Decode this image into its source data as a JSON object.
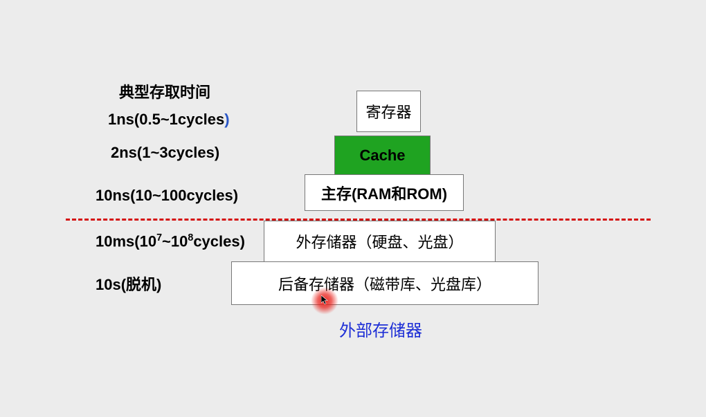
{
  "title": "典型存取时间",
  "times": {
    "t1_pre": "1ns(0.5~1cycles",
    "t1_suf": ")",
    "t2": "2ns(1~3cycles)",
    "t3": "10ns(10~100cycles)",
    "t4_pre": "10ms(10",
    "t4_sup1": "7",
    "t4_mid": "~10",
    "t4_sup2": "8",
    "t4_suf": "cycles)",
    "t5": "10s(脱机)"
  },
  "boxes": {
    "register": "寄存器",
    "cache": "Cache",
    "main": "主存(RAM和ROM)",
    "external": "外存储器（硬盘、光盘）",
    "backup": "后备存储器（磁带库、光盘库）"
  },
  "footer": "外部存储器"
}
